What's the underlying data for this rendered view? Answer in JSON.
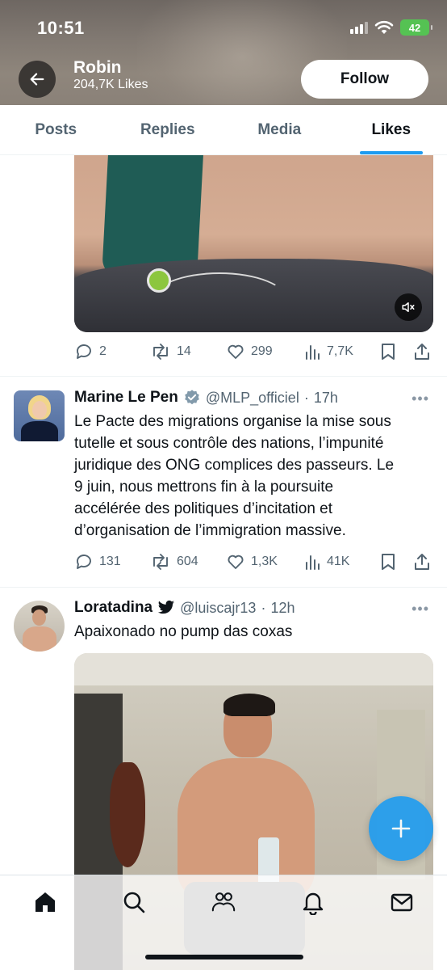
{
  "status_bar": {
    "time": "10:51",
    "battery": "42"
  },
  "profile": {
    "name": "Robin",
    "likes_count": "204,7K Likes",
    "follow_label": "Follow"
  },
  "tabs": [
    {
      "label": "Posts"
    },
    {
      "label": "Replies"
    },
    {
      "label": "Media"
    },
    {
      "label": "Likes",
      "active": true
    }
  ],
  "posts": [
    {
      "stats": {
        "replies": "2",
        "reposts": "14",
        "likes": "299",
        "views": "7,7K"
      }
    },
    {
      "author": "Marine Le Pen",
      "verified": true,
      "handle": "@MLP_officiel",
      "time": "17h",
      "more": "•••",
      "text_lines": [
        "Le Pacte des migrations organise la mise sous",
        "tutelle et sous contrôle des nations, l’impunité",
        "juridique des ONG complices des passeurs. Le",
        "9 juin, nous mettrons fin à la poursuite",
        "accélérée des politiques d’incitation et",
        "d’organisation de l’immigration massive."
      ],
      "stats": {
        "replies": "131",
        "reposts": "604",
        "likes": "1,3K",
        "views": "41K"
      }
    },
    {
      "author": "Loratadina",
      "badge_icon": "twitter-bird-icon",
      "handle": "@luiscajr13",
      "time": "12h",
      "more": "•••",
      "text": "Apaixonado no pump das coxas"
    }
  ],
  "separator": "·",
  "colors": {
    "accent": "#1d9bf0",
    "secondary_text": "#536471",
    "battery_green": "#55c253"
  },
  "bottom_nav": [
    "home-icon",
    "search-icon",
    "communities-icon",
    "notifications-icon",
    "messages-icon"
  ]
}
